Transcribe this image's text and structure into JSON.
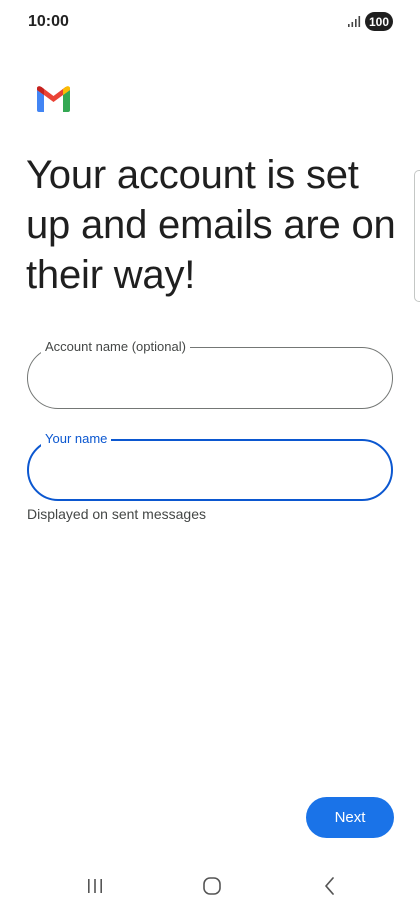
{
  "status_bar": {
    "time": "10:00",
    "battery": "100",
    "signal_icon": "signal-bars-icon"
  },
  "app": {
    "logo_icon": "gmail-logo-icon",
    "title": "Your account is set up and emails are on their way!"
  },
  "form": {
    "account_name": {
      "label": "Account name (optional)",
      "value": "",
      "placeholder": ""
    },
    "your_name": {
      "label": "Your name",
      "value": "",
      "placeholder": "",
      "helper": "Displayed on sent messages",
      "focused": true
    }
  },
  "actions": {
    "next_label": "Next"
  },
  "navigation": {
    "recents_icon": "recents-icon",
    "home_icon": "home-icon",
    "back_icon": "back-icon"
  },
  "colors": {
    "accent": "#1a73e8",
    "focus_outline": "#0b57d0",
    "outline": "#747775",
    "text": "#1f1f1f"
  }
}
